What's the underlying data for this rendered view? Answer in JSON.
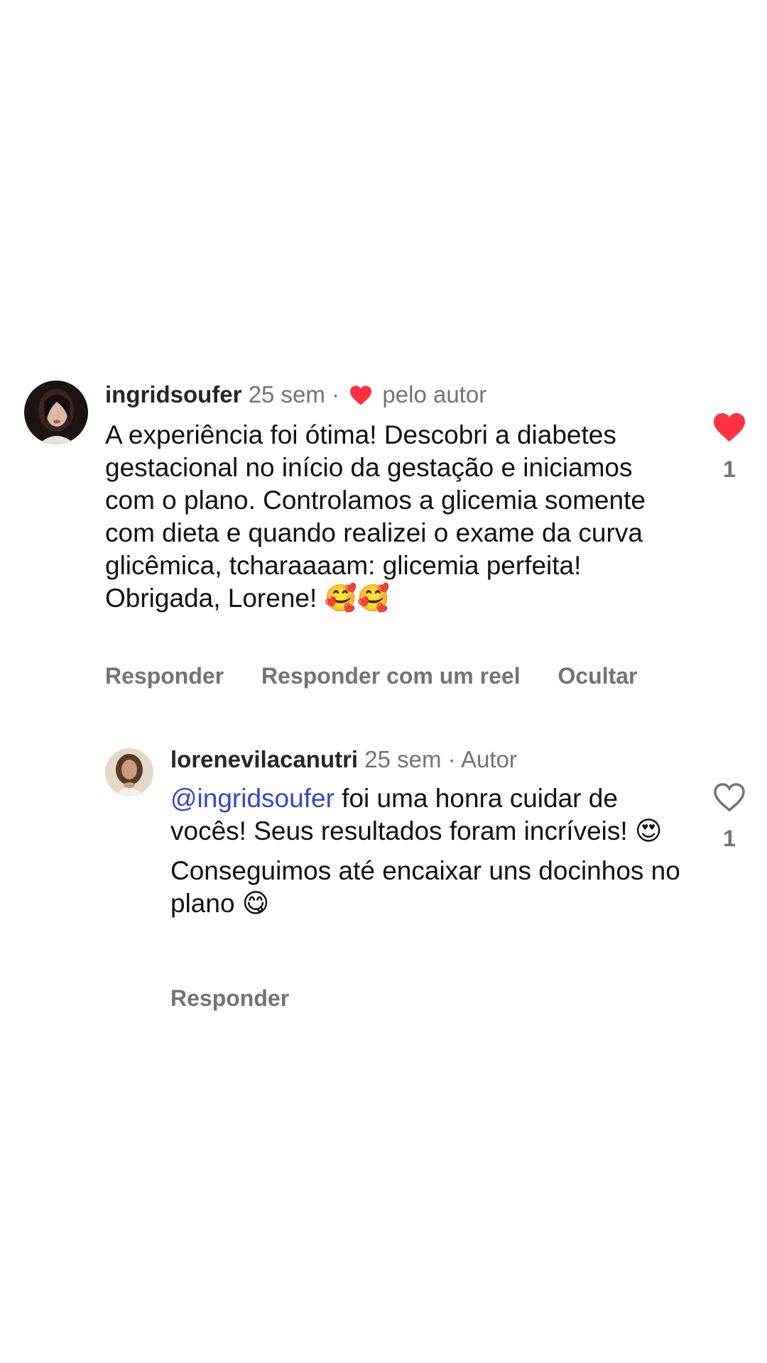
{
  "comments": [
    {
      "username": "ingridsoufer",
      "time": "25 sem",
      "separator": "·",
      "author_badge": "pelo autor",
      "text": "A experiência foi ótima! Descobri a diabetes gestacional no início da gestação e iniciamos com o plano. Controlamos a glicemia somente com dieta e quando realizei o exame da curva glicêmica, tcharaaaam: glicemia perfeita! Obrigada, Lorene! 🥰🥰",
      "actions": {
        "reply": "Responder",
        "reply_reel": "Responder com um reel",
        "hide": "Ocultar"
      },
      "like_count": "1",
      "liked": true,
      "heart_color": "#ff3040"
    },
    {
      "username": "lorenevilacanutri",
      "time": "25 sem",
      "separator": "·",
      "author_tag": "Autor",
      "mention": "@ingridsoufer",
      "text_line1": " foi uma honra cuidar de vocês! Seus resultados foram incríveis! 😍",
      "text_line2": "Conseguimos até encaixar uns docinhos no plano 😋",
      "actions": {
        "reply": "Responder"
      },
      "like_count": "1",
      "liked": false
    }
  ],
  "icons": {
    "liked_heart": "heart-filled-icon",
    "unliked_heart": "heart-outline-icon",
    "inline_heart": "heart-filled-icon"
  },
  "colors": {
    "secondary_text": "#737373",
    "mention": "#3747c4",
    "heart": "#ff3040"
  }
}
